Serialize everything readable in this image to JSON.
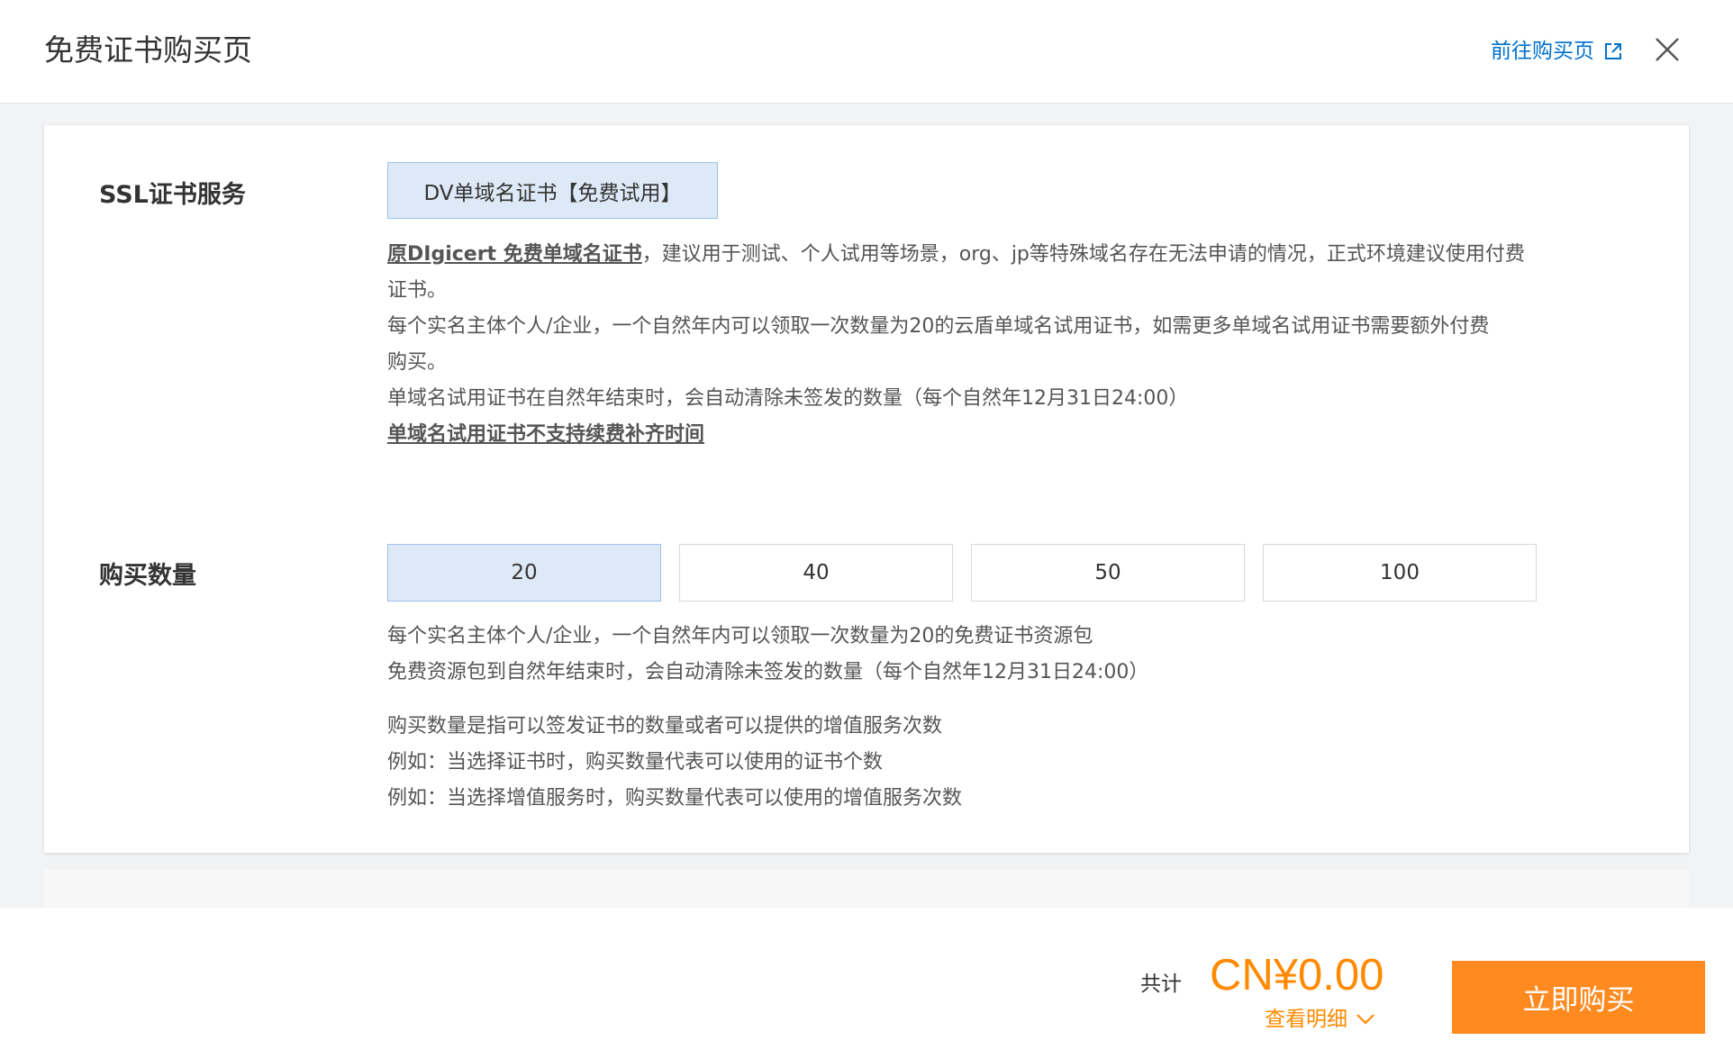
{
  "header": {
    "title": "免费证书购买页",
    "goto_link": "前往购买页"
  },
  "ssl_section": {
    "label": "SSL证书服务",
    "option": "DV单域名证书【免费试用】",
    "desc_link": "原DIgicert 免费单域名证书",
    "desc_line1_rest": "，建议用于测试、个人试用等场景，org、jp等特殊域名存在无法申请的情况，正式环境建议使用付费",
    "desc_line2": "证书。",
    "desc_line3": "每个实名主体个人/企业，一个自然年内可以领取一次数量为20的云盾单域名试用证书，如需更多单域名试用证书需要额外付费",
    "desc_line4": "购买。",
    "desc_line5": "单域名试用证书在自然年结束时，会自动清除未签发的数量（每个自然年12月31日24:00）",
    "desc_line6": "单域名试用证书不支持续费补齐时间"
  },
  "quantity_section": {
    "label": "购买数量",
    "options": [
      "20",
      "40",
      "50",
      "100"
    ],
    "selected": "20",
    "note1": "每个实名主体个人/企业，一个自然年内可以领取一次数量为20的免费证书资源包",
    "note2": "免费资源包到自然年结束时，会自动清除未签发的数量（每个自然年12月31日24:00）",
    "note3": "购买数量是指可以签发证书的数量或者可以提供的增值服务次数",
    "note4": "例如：当选择证书时，购买数量代表可以使用的证书个数",
    "note5": "例如：当选择增值服务时，购买数量代表可以使用的增值服务次数"
  },
  "footer": {
    "total_label": "共计",
    "price": "CN¥0.00",
    "detail_link": "查看明细",
    "buy_button": "立即购买"
  },
  "colors": {
    "accent_orange": "#ff8a1f",
    "link_blue": "#0070cc",
    "selected_bg": "#dde9f6"
  }
}
